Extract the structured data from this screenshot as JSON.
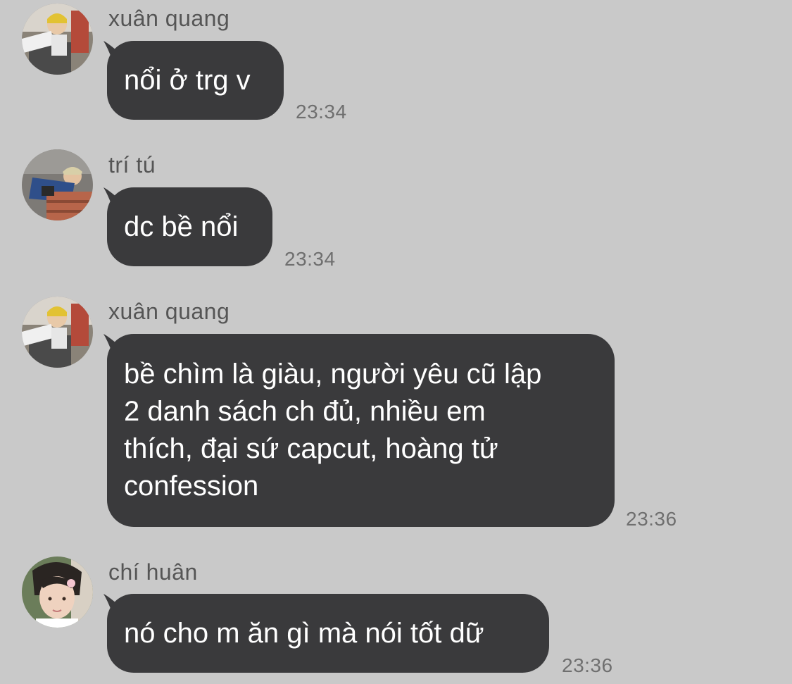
{
  "messages": [
    {
      "sender": "xuân quang",
      "avatar_icon": "avatar-xuan-quang-icon",
      "text": "nổi ở trg v",
      "time": "23:34"
    },
    {
      "sender": "trí tú",
      "avatar_icon": "avatar-tri-tu-icon",
      "text": "dc bề nổi",
      "time": "23:34"
    },
    {
      "sender": "xuân quang",
      "avatar_icon": "avatar-xuan-quang-icon",
      "text": "bề chìm là giàu, người yêu cũ lập\n2 danh sách ch đủ, nhiều em\nthích, đại sứ capcut, hoàng tử\nconfession",
      "time": "23:36"
    },
    {
      "sender": "chí huân",
      "avatar_icon": "avatar-chi-huan-icon",
      "text": "nó cho m ăn gì mà nói tốt dữ",
      "time": "23:36"
    }
  ],
  "colors": {
    "background": "#c9c9c9",
    "bubble": "#3a3a3c",
    "bubble_text": "#ffffff",
    "sender_text": "#555555",
    "time_text": "#6f6f6f"
  }
}
